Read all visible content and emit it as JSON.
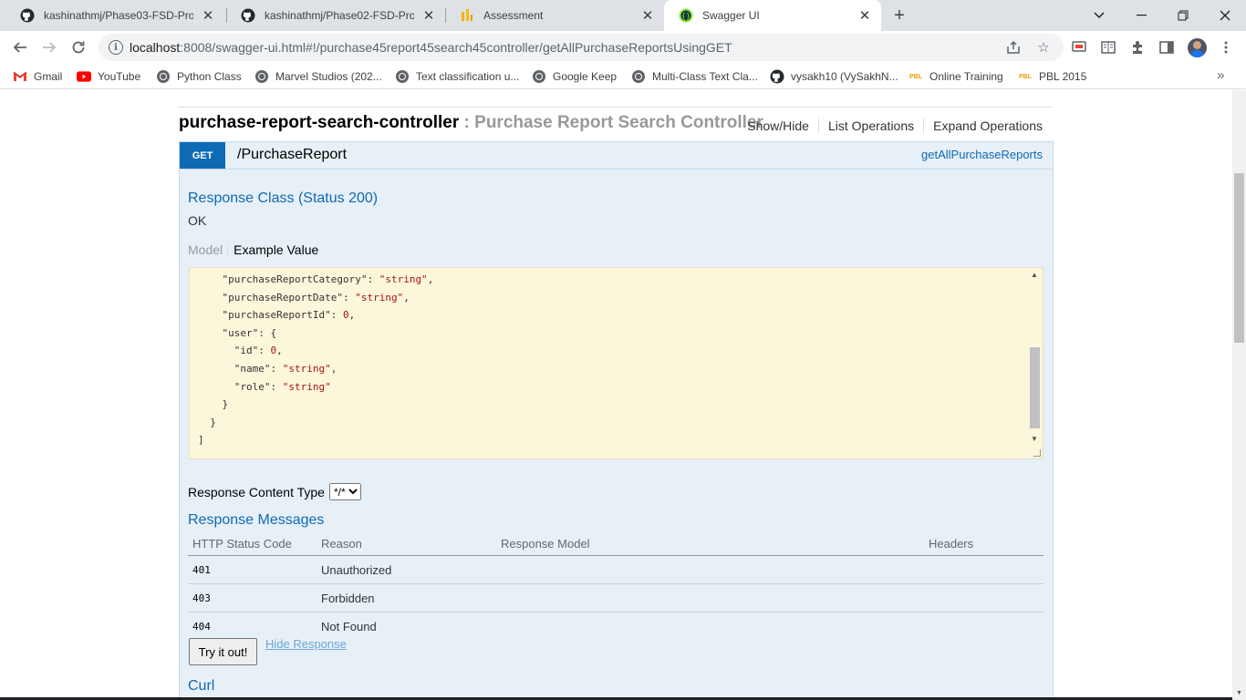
{
  "browser": {
    "tabs": [
      {
        "title": "kashinathmj/Phase03-FSD-Projec",
        "icon": "github-icon"
      },
      {
        "title": "kashinathmj/Phase02-FSD-Projec",
        "icon": "github-icon"
      },
      {
        "title": "Assessment",
        "icon": "bar-chart-icon"
      },
      {
        "title": "Swagger UI",
        "icon": "swagger-icon",
        "active": true
      }
    ],
    "url_host": "localhost",
    "url_rest": ":8008/swagger-ui.html#!/purchase45report45search45controller/getAllPurchaseReportsUsingGET",
    "bookmarks": [
      {
        "label": "Gmail",
        "icon": "gmail-icon"
      },
      {
        "label": "YouTube",
        "icon": "youtube-icon"
      },
      {
        "label": "Python Class",
        "icon": "globe-icon"
      },
      {
        "label": "Marvel Studios (202...",
        "icon": "globe-icon"
      },
      {
        "label": "Text classification u...",
        "icon": "globe-icon"
      },
      {
        "label": "Google Keep",
        "icon": "globe-icon"
      },
      {
        "label": "Multi-Class Text Cla...",
        "icon": "globe-icon"
      },
      {
        "label": "vysakh10 (VySakhN...",
        "icon": "github-icon"
      },
      {
        "label": "Online Training",
        "icon": "pbl-icon"
      },
      {
        "label": "PBL 2015",
        "icon": "pbl-icon"
      }
    ]
  },
  "resource": {
    "name": "purchase-report-search-controller",
    "separator": " : ",
    "description": "Purchase Report Search Controller",
    "links": [
      "Show/Hide",
      "List Operations",
      "Expand Operations"
    ]
  },
  "operation": {
    "method": "GET",
    "path": "/PurchaseReport",
    "nickname": "getAllPurchaseReports",
    "response_class_heading": "Response Class (Status 200)",
    "response_class_value": "OK",
    "model_tab": "Model",
    "example_tab": "Example Value",
    "example_lines": [
      {
        "indent": "    ",
        "key": "\"purchaseReportCategory\"",
        "value": "\"string\"",
        "trail": ","
      },
      {
        "indent": "    ",
        "key": "\"purchaseReportDate\"",
        "value": "\"string\"",
        "trail": ","
      },
      {
        "indent": "    ",
        "key": "\"purchaseReportId\"",
        "value": "0",
        "trail": ","
      },
      {
        "indent": "    ",
        "key": "\"user\"",
        "value": "{",
        "trail": ""
      },
      {
        "indent": "      ",
        "key": "\"id\"",
        "value": "0",
        "trail": ","
      },
      {
        "indent": "      ",
        "key": "\"name\"",
        "value": "\"string\"",
        "trail": ","
      },
      {
        "indent": "      ",
        "key": "\"role\"",
        "value": "\"string\"",
        "trail": ""
      },
      {
        "indent": "    ",
        "key": "",
        "value": "}",
        "trail": ""
      },
      {
        "indent": "  ",
        "key": "",
        "value": "}",
        "trail": ""
      },
      {
        "indent": "",
        "key": "",
        "value": "]",
        "trail": ""
      }
    ],
    "content_type_label": "Response Content Type",
    "content_type_value": "*/*",
    "response_messages_heading": "Response Messages",
    "response_headers": [
      "HTTP Status Code",
      "Reason",
      "Response Model",
      "Headers"
    ],
    "response_rows": [
      {
        "code": "401",
        "reason": "Unauthorized",
        "model": "",
        "headers": ""
      },
      {
        "code": "403",
        "reason": "Forbidden",
        "model": "",
        "headers": ""
      },
      {
        "code": "404",
        "reason": "Not Found",
        "model": "",
        "headers": ""
      }
    ],
    "try_button": "Try it out!",
    "hide_response": "Hide Response",
    "curl_heading": "Curl"
  }
}
